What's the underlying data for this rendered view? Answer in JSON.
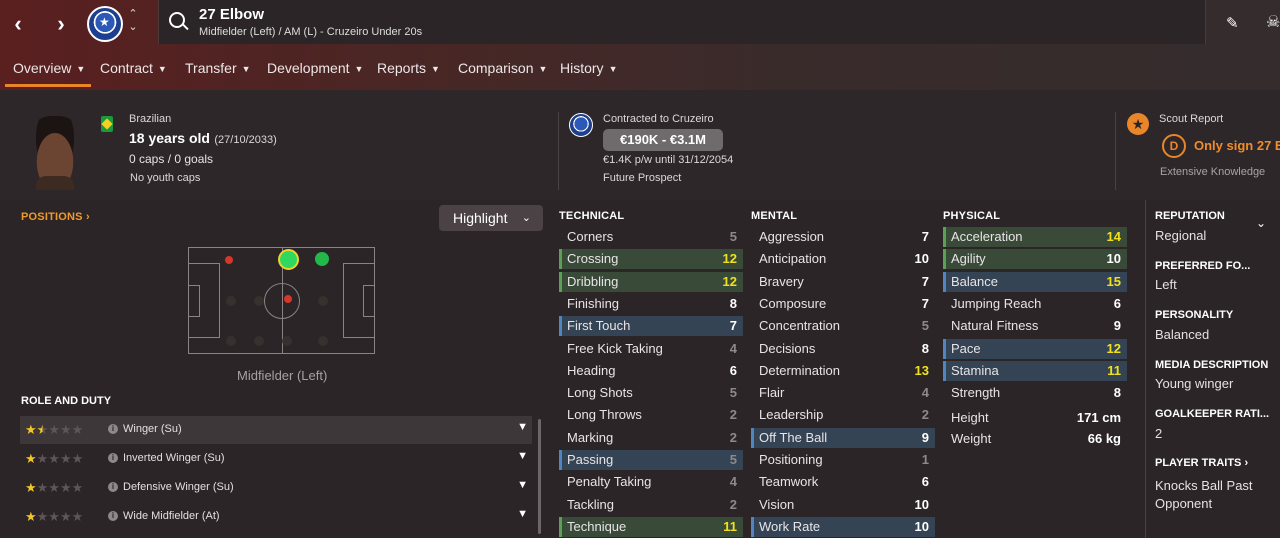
{
  "header": {
    "player_name": "27 Elbow",
    "player_subtitle": "Midfielder (Left) / AM (L) - Cruzeiro Under 20s"
  },
  "tabs": [
    {
      "label": "Overview"
    },
    {
      "label": "Contract"
    },
    {
      "label": "Transfer"
    },
    {
      "label": "Development"
    },
    {
      "label": "Reports"
    },
    {
      "label": "Comparison"
    },
    {
      "label": "History"
    }
  ],
  "bio": {
    "nationality": "Brazilian",
    "age": "18 years old",
    "dob": "(27/10/2033)",
    "caps": "0 caps / 0 goals",
    "youth_caps": "No youth caps"
  },
  "contract": {
    "contracted_to": "Contracted to Cruzeiro",
    "value": "€190K - €3.1M",
    "wage": "€1.4K p/w until 31/12/2054",
    "status": "Future Prospect"
  },
  "scout": {
    "title": "Scout Report",
    "grade": "D",
    "recommendation": "Only sign 27 E",
    "knowledge": "Extensive Knowledge"
  },
  "positions": {
    "heading": "POSITIONS",
    "chevron": "›",
    "highlight_label": "Highlight",
    "selected_position": "Midfielder (Left)"
  },
  "roles": {
    "heading": "ROLE AND DUTY",
    "items": [
      {
        "name": "Winger (Su)",
        "stars": 1.5
      },
      {
        "name": "Inverted Winger (Su)",
        "stars": 1
      },
      {
        "name": "Defensive Winger (Su)",
        "stars": 1
      },
      {
        "name": "Wide Midfielder (At)",
        "stars": 1
      }
    ]
  },
  "attributes": {
    "technical": {
      "heading": "TECHNICAL",
      "items": [
        {
          "name": "Corners",
          "value": "5",
          "hl": ""
        },
        {
          "name": "Crossing",
          "value": "12",
          "hl": "green"
        },
        {
          "name": "Dribbling",
          "value": "12",
          "hl": "green"
        },
        {
          "name": "Finishing",
          "value": "8",
          "hl": ""
        },
        {
          "name": "First Touch",
          "value": "7",
          "hl": "blue"
        },
        {
          "name": "Free Kick Taking",
          "value": "4",
          "hl": ""
        },
        {
          "name": "Heading",
          "value": "6",
          "hl": ""
        },
        {
          "name": "Long Shots",
          "value": "5",
          "hl": ""
        },
        {
          "name": "Long Throws",
          "value": "2",
          "hl": ""
        },
        {
          "name": "Marking",
          "value": "2",
          "hl": ""
        },
        {
          "name": "Passing",
          "value": "5",
          "hl": "blue"
        },
        {
          "name": "Penalty Taking",
          "value": "4",
          "hl": ""
        },
        {
          "name": "Tackling",
          "value": "2",
          "hl": ""
        },
        {
          "name": "Technique",
          "value": "11",
          "hl": "green"
        }
      ]
    },
    "mental": {
      "heading": "MENTAL",
      "items": [
        {
          "name": "Aggression",
          "value": "7",
          "hl": ""
        },
        {
          "name": "Anticipation",
          "value": "10",
          "hl": ""
        },
        {
          "name": "Bravery",
          "value": "7",
          "hl": ""
        },
        {
          "name": "Composure",
          "value": "7",
          "hl": ""
        },
        {
          "name": "Concentration",
          "value": "5",
          "hl": ""
        },
        {
          "name": "Decisions",
          "value": "8",
          "hl": ""
        },
        {
          "name": "Determination",
          "value": "13",
          "hl": ""
        },
        {
          "name": "Flair",
          "value": "4",
          "hl": ""
        },
        {
          "name": "Leadership",
          "value": "2",
          "hl": ""
        },
        {
          "name": "Off The Ball",
          "value": "9",
          "hl": "blue"
        },
        {
          "name": "Positioning",
          "value": "1",
          "hl": ""
        },
        {
          "name": "Teamwork",
          "value": "6",
          "hl": ""
        },
        {
          "name": "Vision",
          "value": "10",
          "hl": ""
        },
        {
          "name": "Work Rate",
          "value": "10",
          "hl": "blue"
        }
      ]
    },
    "physical": {
      "heading": "PHYSICAL",
      "items": [
        {
          "name": "Acceleration",
          "value": "14",
          "hl": "green"
        },
        {
          "name": "Agility",
          "value": "10",
          "hl": "green"
        },
        {
          "name": "Balance",
          "value": "15",
          "hl": "blue"
        },
        {
          "name": "Jumping Reach",
          "value": "6",
          "hl": ""
        },
        {
          "name": "Natural Fitness",
          "value": "9",
          "hl": ""
        },
        {
          "name": "Pace",
          "value": "12",
          "hl": "blue"
        },
        {
          "name": "Stamina",
          "value": "11",
          "hl": "blue"
        },
        {
          "name": "Strength",
          "value": "8",
          "hl": ""
        }
      ],
      "height_label": "Height",
      "height": "171 cm",
      "weight_label": "Weight",
      "weight": "66 kg"
    }
  },
  "side": {
    "reputation_h": "REPUTATION",
    "reputation": "Regional",
    "foot_h": "PREFERRED FO...",
    "foot": "Left",
    "personality_h": "PERSONALITY",
    "personality": "Balanced",
    "media_h": "MEDIA DESCRIPTION",
    "media": "Young winger",
    "gk_h": "GOALKEEPER RATI...",
    "gk": "2",
    "traits_h": "PLAYER TRAITS",
    "traits_chev": "›",
    "trait1a": "Knocks Ball Past",
    "trait1b": "Opponent"
  },
  "colors": {
    "accent": "#e9862a",
    "highlight_value": "#f1e11c",
    "green_highlight": "#3a4a39",
    "blue_highlight": "#344455"
  }
}
